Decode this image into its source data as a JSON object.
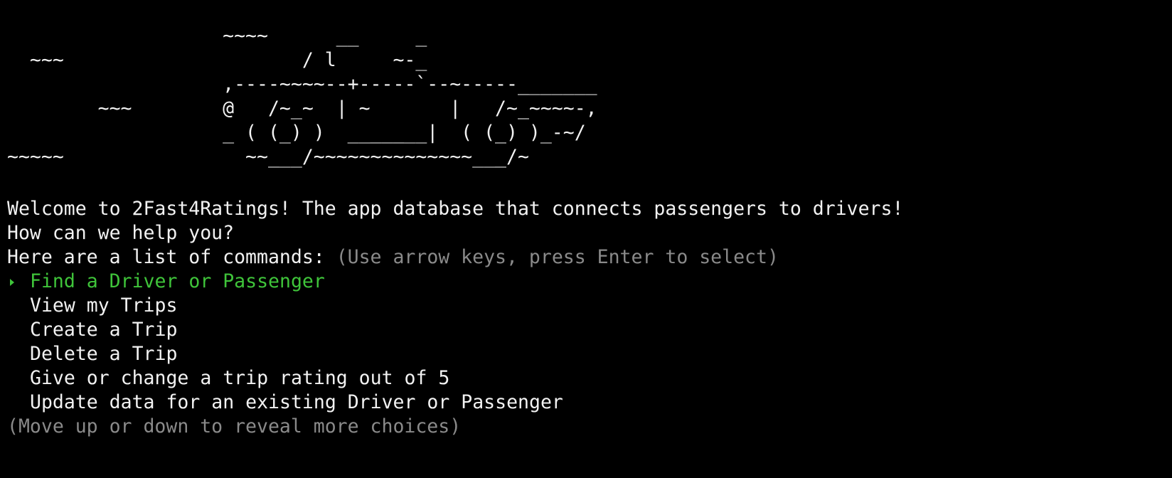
{
  "ascii_art": [
    "",
    "                   ~~~~      __     _",
    "  ~~~                     / l     ~-_",
    "                   ,----~~~~--+-----`--~-----_______",
    "        ~~~        @   /~_~  | ~       |   /~_~~~~-,",
    "                   _ ( (_) )  _______|  ( (_) )_-~/",
    "~~~~~                ~~___/~~~~~~~~~~~~~~___/~",
    ""
  ],
  "welcome": "Welcome to 2Fast4Ratings! The app database that connects passengers to drivers!",
  "help_prompt": "How can we help you?",
  "commands_label": "Here are a list of commands: ",
  "commands_hint": "(Use arrow keys, press Enter to select)",
  "menu": {
    "items": [
      "Find a Driver or Passenger",
      "View my Trips",
      "Create a Trip",
      "Delete a Trip",
      "Give or change a trip rating out of 5",
      "Update data for an existing Driver or Passenger"
    ]
  },
  "scroll_hint": "(Move up or down to reveal more choices)",
  "colors": {
    "background": "#000000",
    "foreground": "#f2f2f2",
    "selected": "#3fc43a",
    "dim": "#8a8a8a"
  }
}
